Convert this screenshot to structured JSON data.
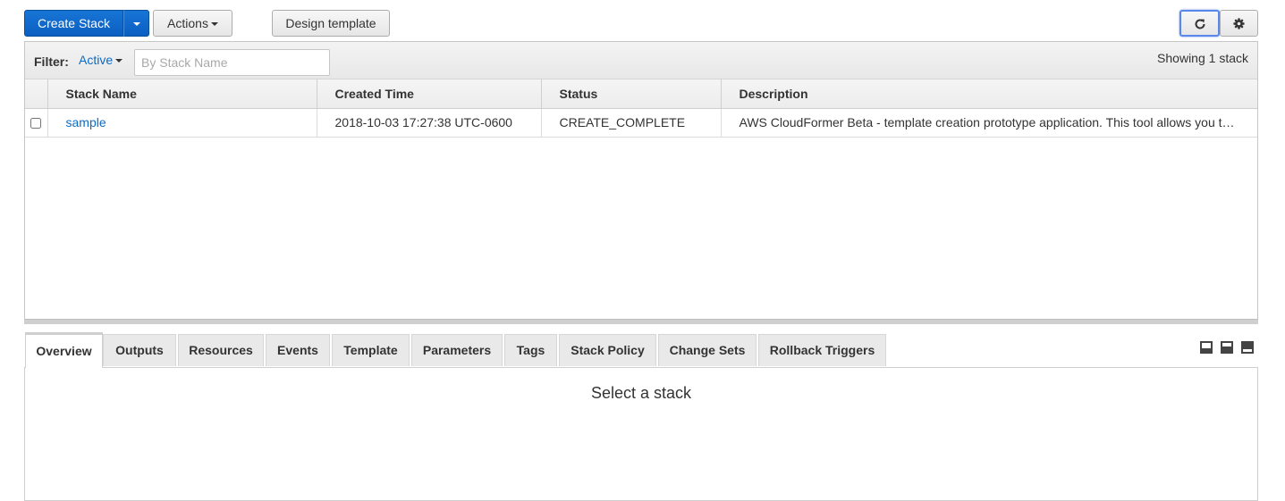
{
  "toolbar": {
    "create_stack": "Create Stack",
    "actions": "Actions",
    "design_template": "Design template"
  },
  "filter": {
    "label": "Filter:",
    "status": "Active",
    "placeholder": "By Stack Name",
    "value": "",
    "showing": "Showing 1 stack"
  },
  "table": {
    "headers": [
      "Stack Name",
      "Created Time",
      "Status",
      "Description"
    ],
    "rows": [
      {
        "name": "sample",
        "created": "2018-10-03 17:27:38 UTC-0600",
        "status": "CREATE_COMPLETE",
        "description": "AWS CloudFormer Beta - template creation prototype application. This tool allows you to create an AWS CloudFormation template from the AWS resources in your account."
      }
    ]
  },
  "tabs": [
    "Overview",
    "Outputs",
    "Resources",
    "Events",
    "Template",
    "Parameters",
    "Tags",
    "Stack Policy",
    "Change Sets",
    "Rollback Triggers"
  ],
  "detail": {
    "message": "Select a stack"
  },
  "colors": {
    "primary": "#0b5fc1",
    "link": "#0b6bc4",
    "status_ok": "#1d9928",
    "focus_ring": "#5a87ea"
  },
  "icons": [
    "caret-down-icon",
    "refresh-icon",
    "gear-icon",
    "pane-bottom-icon",
    "pane-half-icon",
    "pane-full-icon"
  ]
}
